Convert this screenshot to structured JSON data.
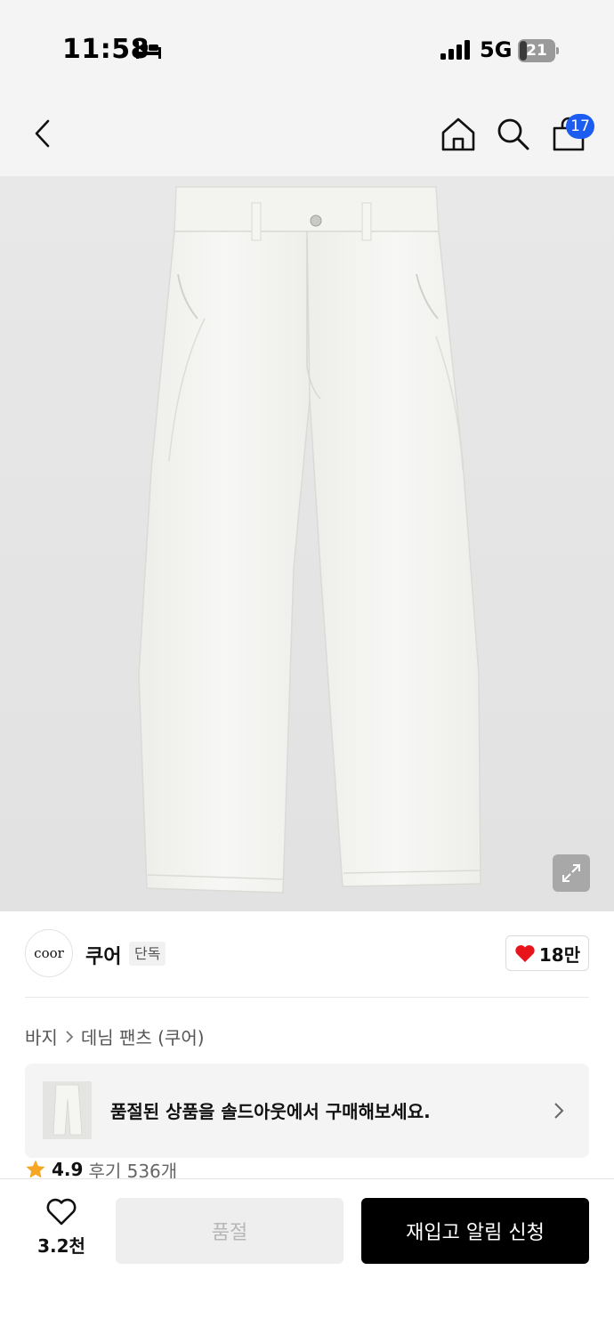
{
  "status_bar": {
    "time": "11:58",
    "network": "5G",
    "battery_level": "21",
    "battery_fraction": 0.21,
    "sleep_icon": "bed-icon",
    "signal_icon": "cellular-signal-icon"
  },
  "nav": {
    "back_icon": "chevron-left-icon",
    "home_icon": "home-icon",
    "search_icon": "search-icon",
    "cart_icon": "shopping-bag-icon",
    "cart_badge": "17",
    "badge_color": "#1d5cf1"
  },
  "product_image": {
    "subject": "white-denim-pants",
    "expand_icon": "expand-arrows-icon"
  },
  "brand": {
    "logo_text": "coor",
    "name": "쿠어",
    "exclusive_label": "단독",
    "like_icon": "heart-filled-icon",
    "like_color": "#e8141b",
    "like_count": "18만"
  },
  "breadcrumb": {
    "items": [
      "바지",
      "데님 팬츠 (쿠어)"
    ],
    "separator_icon": "chevron-right-icon"
  },
  "soldout_banner": {
    "text": "품절된 상품을 솔드아웃에서 구매해보세요.",
    "chevron_icon": "chevron-right-icon"
  },
  "rating": {
    "star_icon": "star-icon",
    "star_color": "#f5a623",
    "value": "4.9",
    "review_text": "후기 536개"
  },
  "bottom_bar": {
    "wish_icon": "heart-outline-icon",
    "wish_count": "3.2천",
    "soldout_label": "품절",
    "restock_label": "재입고 알림 신청"
  }
}
